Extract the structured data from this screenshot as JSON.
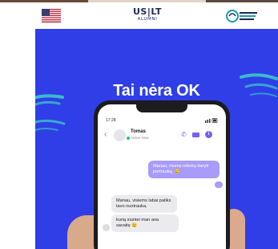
{
  "header": {
    "logo_main": "US|LT",
    "logo_sub": "ALUMNI"
  },
  "poster": {
    "headline": "Tai nėra OK"
  },
  "chat": {
    "status_time": "17:28",
    "contact_name": "Tomas",
    "contact_status": "Active Now",
    "messages": {
      "outgoing_1": "Manau, mums reikėtų daryti pertrauką. 😢",
      "incoming_1": "Manau, visiems labai patiks tavo nuotrauka,",
      "incoming_2": "kurią siuntei man ana savaitę 😉"
    }
  },
  "colors": {
    "poster_bg": "#2f3ee6",
    "bubble_out": "#a89cf8",
    "bubble_in": "#ebebee",
    "accent": "#7b5cf5"
  },
  "icons": {
    "flag": "us-flag-icon",
    "back": "chevron-left-icon",
    "call": "phone-icon",
    "video": "video-camera-icon",
    "info": "info-icon"
  }
}
